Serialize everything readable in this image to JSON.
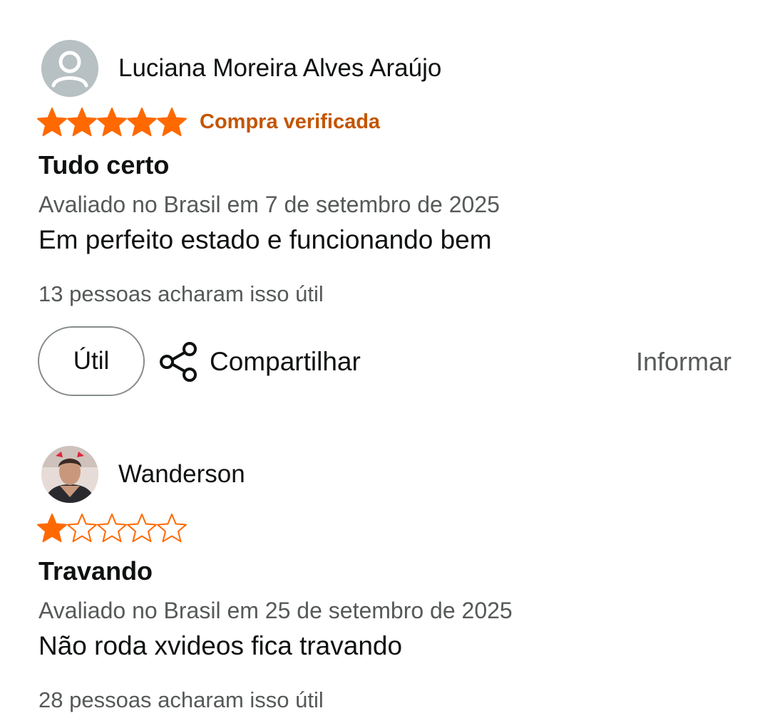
{
  "colors": {
    "star_fill": "#ff6900",
    "verified": "#c45500",
    "secondary_text": "#565959",
    "primary_text": "#0f1111"
  },
  "reviews": [
    {
      "reviewer": "Luciana Moreira Alves Araújo",
      "avatar_icon": "default-person-icon",
      "rating": 5,
      "rating_max": 5,
      "verified_label": "Compra verificada",
      "title": "Tudo certo",
      "date": "Avaliado no Brasil em 7 de setembro de 2025",
      "body": "Em perfeito estado e funcionando bem",
      "helpful_count": "13 pessoas acharam isso útil",
      "actions": {
        "helpful_label": "Útil",
        "share_label": "Compartilhar",
        "share_icon": "share-icon",
        "report_label": "Informar"
      }
    },
    {
      "reviewer": "Wanderson",
      "avatar_icon": "profile-photo",
      "rating": 1,
      "rating_max": 5,
      "title": "Travando",
      "date": "Avaliado no Brasil em 25 de setembro de 2025",
      "body": "Não roda xvideos fica travando",
      "helpful_count": "28 pessoas acharam isso útil"
    }
  ]
}
